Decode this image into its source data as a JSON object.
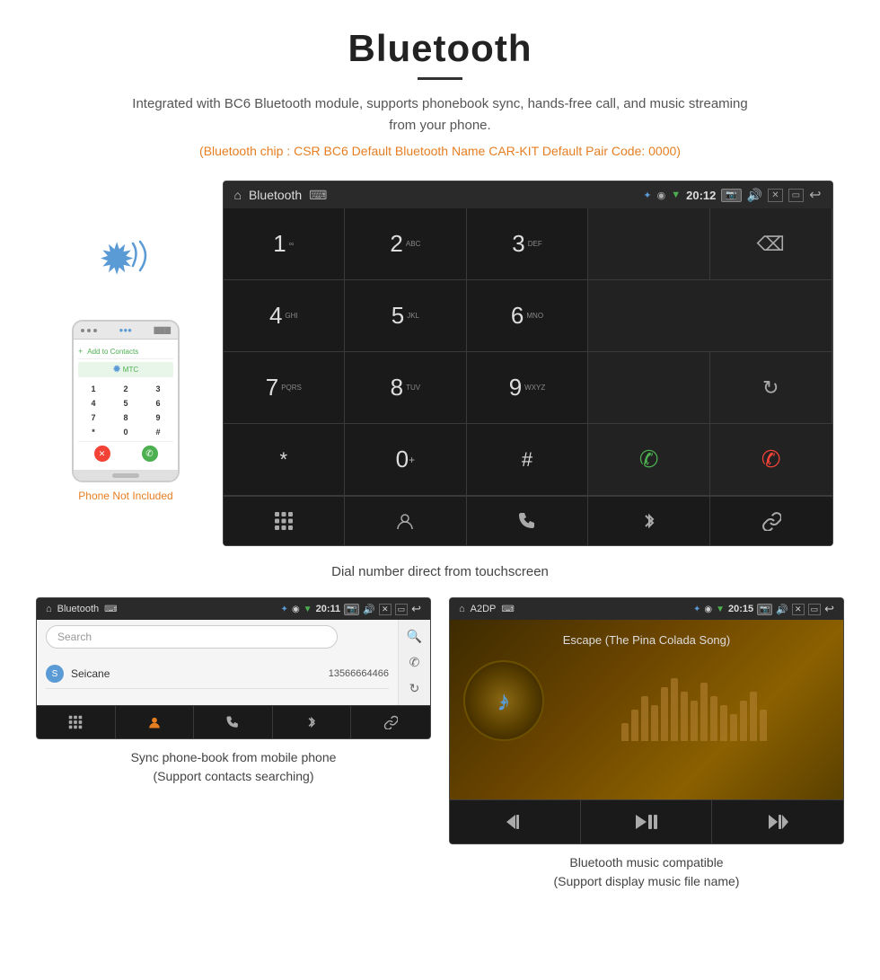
{
  "page": {
    "title": "Bluetooth",
    "divider": true,
    "subtitle": "Integrated with BC6 Bluetooth module, supports phonebook sync, hands-free call, and music streaming from your phone.",
    "spec_line": "(Bluetooth chip : CSR BC6    Default Bluetooth Name CAR-KIT    Default Pair Code: 0000)",
    "main_caption": "Dial number direct from touchscreen",
    "bottom_left_caption_line1": "Sync phone-book from mobile phone",
    "bottom_left_caption_line2": "(Support contacts searching)",
    "bottom_right_caption_line1": "Bluetooth music compatible",
    "bottom_right_caption_line2": "(Support display music file name)"
  },
  "car_screen_main": {
    "status_title": "Bluetooth",
    "time": "20:12",
    "usb_symbol": "⌨",
    "home_icon": "⌂",
    "dialpad": [
      {
        "key": "1",
        "sub": "∞",
        "col": 1
      },
      {
        "key": "2",
        "sub": "ABC",
        "col": 2
      },
      {
        "key": "3",
        "sub": "DEF",
        "col": 3
      },
      {
        "key": "backspace",
        "col": 5
      },
      {
        "key": "4",
        "sub": "GHI",
        "col": 1
      },
      {
        "key": "5",
        "sub": "JKL",
        "col": 2
      },
      {
        "key": "6",
        "sub": "MNO",
        "col": 3
      },
      {
        "key": "7",
        "sub": "PQRS",
        "col": 1
      },
      {
        "key": "8",
        "sub": "TUV",
        "col": 2
      },
      {
        "key": "9",
        "sub": "WXYZ",
        "col": 3
      },
      {
        "key": "reload",
        "col": 5
      },
      {
        "key": "*",
        "col": 1
      },
      {
        "key": "0+",
        "col": 2
      },
      {
        "key": "#",
        "col": 3
      },
      {
        "key": "call_green",
        "col": 4
      },
      {
        "key": "call_red",
        "col": 5
      }
    ],
    "bottom_nav": [
      "⊞",
      "👤",
      "✆",
      "✦",
      "🔗"
    ]
  },
  "phonebook_screen": {
    "status_title": "Bluetooth",
    "time": "20:11",
    "search_placeholder": "Search",
    "contacts": [
      {
        "letter": "S",
        "name": "Seicane",
        "number": "13566664466"
      }
    ],
    "bottom_nav": [
      "⊞",
      "👤",
      "✆",
      "✦",
      "🔗"
    ]
  },
  "music_screen": {
    "status_title": "A2DP",
    "time": "20:15",
    "song_title": "Escape (The Pina Colada Song)",
    "eq_bars": [
      20,
      35,
      50,
      40,
      60,
      70,
      55,
      45,
      65,
      50,
      40,
      30,
      45,
      55,
      35
    ],
    "controls": [
      "⏮",
      "⏯",
      "⏭"
    ]
  },
  "phone_device": {
    "keypad": [
      "1",
      "2",
      "3",
      "4",
      "5",
      "6",
      "7",
      "8",
      "9",
      "*",
      "0",
      "#"
    ],
    "not_included_label": "Phone Not Included"
  }
}
